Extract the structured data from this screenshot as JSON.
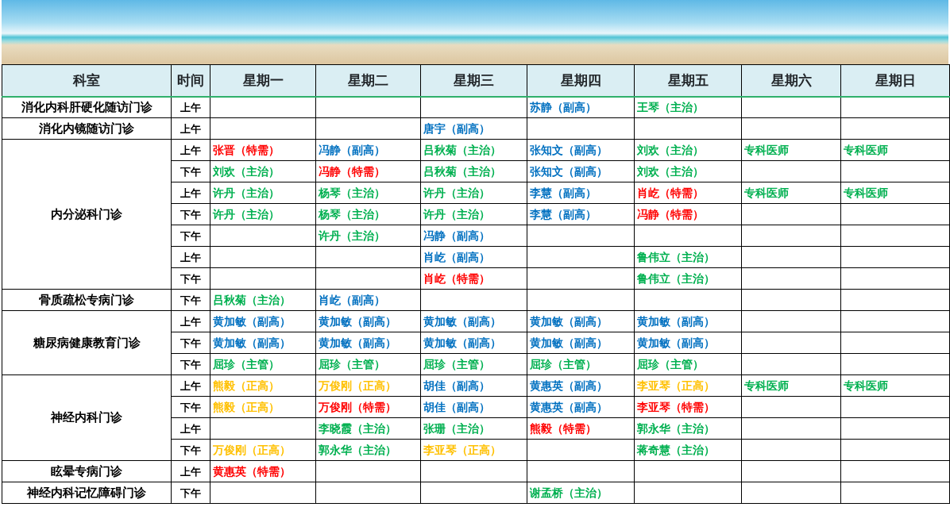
{
  "columns": [
    "科室",
    "时间",
    "星期一",
    "星期二",
    "星期三",
    "星期四",
    "星期五",
    "星期六",
    "星期日"
  ],
  "departments": [
    {
      "name": "消化内科肝硬化随访门诊",
      "rows": [
        {
          "time": "上午",
          "cells": [
            null,
            null,
            null,
            {
              "text": "苏静（副高）",
              "color": "#0070c0"
            },
            {
              "text": "王琴（主治）",
              "color": "#00b050"
            },
            null,
            null
          ]
        }
      ]
    },
    {
      "name": "消化内镜随访门诊",
      "rows": [
        {
          "time": "上午",
          "cells": [
            null,
            null,
            {
              "text": "唐宇（副高）",
              "color": "#0070c0"
            },
            null,
            null,
            null,
            null
          ]
        }
      ]
    },
    {
      "name": "内分泌科门诊",
      "rows": [
        {
          "time": "上午",
          "cells": [
            {
              "text": "张晋（特需）",
              "color": "#ff0000"
            },
            {
              "text": "冯静（副高）",
              "color": "#0070c0"
            },
            {
              "text": "吕秋菊（主治）",
              "color": "#00b050"
            },
            {
              "text": "张知文（副高）",
              "color": "#0070c0"
            },
            {
              "text": "刘欢（主治）",
              "color": "#00b050"
            },
            {
              "text": "专科医师",
              "color": "#00b050"
            },
            {
              "text": "专科医师",
              "color": "#00b050"
            }
          ]
        },
        {
          "time": "下午",
          "cells": [
            {
              "text": "刘欢（主治）",
              "color": "#00b050"
            },
            {
              "text": "冯静（特需）",
              "color": "#ff0000"
            },
            {
              "text": "吕秋菊（主治）",
              "color": "#00b050"
            },
            {
              "text": "张知文（副高）",
              "color": "#0070c0"
            },
            {
              "text": "刘欢（主治）",
              "color": "#00b050"
            },
            null,
            null
          ]
        },
        {
          "time": "上午",
          "cells": [
            {
              "text": "许丹（主治）",
              "color": "#00b050"
            },
            {
              "text": "杨琴（主治）",
              "color": "#00b050"
            },
            {
              "text": "许丹（主治）",
              "color": "#00b050"
            },
            {
              "text": "李慧（副高）",
              "color": "#0070c0"
            },
            {
              "text": "肖屹（特需）",
              "color": "#ff0000"
            },
            {
              "text": "专科医师",
              "color": "#00b050"
            },
            {
              "text": "专科医师",
              "color": "#00b050"
            }
          ]
        },
        {
          "time": "下午",
          "cells": [
            {
              "text": "许丹（主治）",
              "color": "#00b050"
            },
            {
              "text": "杨琴（主治）",
              "color": "#00b050"
            },
            {
              "text": "许丹（主治）",
              "color": "#00b050"
            },
            {
              "text": "李慧（副高）",
              "color": "#0070c0"
            },
            {
              "text": "冯静（特需）",
              "color": "#ff0000"
            },
            null,
            null
          ]
        },
        {
          "time": "下午",
          "cells": [
            null,
            {
              "text": "许丹（主治）",
              "color": "#00b050"
            },
            {
              "text": "冯静（副高）",
              "color": "#0070c0"
            },
            null,
            null,
            null,
            null
          ]
        },
        {
          "time": "上午",
          "cells": [
            null,
            null,
            {
              "text": "肖屹（副高）",
              "color": "#0070c0"
            },
            null,
            {
              "text": "鲁伟立（主治）",
              "color": "#00b050"
            },
            null,
            null
          ]
        },
        {
          "time": "下午",
          "cells": [
            null,
            null,
            {
              "text": "肖屹（特需）",
              "color": "#ff0000"
            },
            null,
            {
              "text": "鲁伟立（主治）",
              "color": "#00b050"
            },
            null,
            null
          ]
        }
      ]
    },
    {
      "name": "骨质疏松专病门诊",
      "rows": [
        {
          "time": "下午",
          "cells": [
            {
              "text": "吕秋菊（主治）",
              "color": "#00b050"
            },
            {
              "text": "肖屹（副高）",
              "color": "#0070c0"
            },
            null,
            null,
            null,
            null,
            null
          ]
        }
      ]
    },
    {
      "name": "糖尿病健康教育门诊",
      "rows": [
        {
          "time": "上午",
          "cells": [
            {
              "text": "黄加敏（副高）",
              "color": "#0070c0"
            },
            {
              "text": "黄加敏（副高）",
              "color": "#0070c0"
            },
            {
              "text": "黄加敏（副高）",
              "color": "#0070c0"
            },
            {
              "text": "黄加敏（副高）",
              "color": "#0070c0"
            },
            {
              "text": "黄加敏（副高）",
              "color": "#0070c0"
            },
            null,
            null
          ]
        },
        {
          "time": "下午",
          "cells": [
            {
              "text": "黄加敏（副高）",
              "color": "#0070c0"
            },
            {
              "text": "黄加敏（副高）",
              "color": "#0070c0"
            },
            {
              "text": "黄加敏（副高）",
              "color": "#0070c0"
            },
            {
              "text": "黄加敏（副高）",
              "color": "#0070c0"
            },
            {
              "text": "黄加敏（副高）",
              "color": "#0070c0"
            },
            null,
            null
          ]
        },
        {
          "time": "下午",
          "cells": [
            {
              "text": "屈珍（主管）",
              "color": "#00b050"
            },
            {
              "text": "屈珍（主管）",
              "color": "#00b050"
            },
            {
              "text": "屈珍（主管）",
              "color": "#00b050"
            },
            {
              "text": "屈珍（主管）",
              "color": "#00b050"
            },
            {
              "text": "屈珍（主管）",
              "color": "#00b050"
            },
            null,
            null
          ]
        }
      ]
    },
    {
      "name": "神经内科门诊",
      "rows": [
        {
          "time": "上午",
          "cells": [
            {
              "text": "熊毅（正高）",
              "color": "#ffc000"
            },
            {
              "text": "万俊刚（正高）",
              "color": "#ffc000"
            },
            {
              "text": "胡佳（副高）",
              "color": "#0070c0"
            },
            {
              "text": "黄惠英（副高）",
              "color": "#0070c0"
            },
            {
              "text": "李亚琴（正高）",
              "color": "#ffc000"
            },
            {
              "text": "专科医师",
              "color": "#00b050"
            },
            {
              "text": "专科医师",
              "color": "#00b050"
            }
          ]
        },
        {
          "time": "下午",
          "cells": [
            {
              "text": "熊毅（正高）",
              "color": "#ffc000"
            },
            {
              "text": "万俊刚（特需）",
              "color": "#ff0000"
            },
            {
              "text": "胡佳（副高）",
              "color": "#0070c0"
            },
            {
              "text": "黄惠英（副高）",
              "color": "#0070c0"
            },
            {
              "text": "李亚琴（特需）",
              "color": "#ff0000"
            },
            null,
            null
          ]
        },
        {
          "time": "上午",
          "cells": [
            null,
            {
              "text": "李晓霞（主治）",
              "color": "#00b050"
            },
            {
              "text": "张珊（主治）",
              "color": "#00b050"
            },
            {
              "text": "熊毅（特需）",
              "color": "#ff0000"
            },
            {
              "text": "郭永华（主治）",
              "color": "#00b050"
            },
            null,
            null
          ]
        },
        {
          "time": "下午",
          "cells": [
            {
              "text": "万俊刚（正高）",
              "color": "#ffc000"
            },
            {
              "text": "郭永华（主治）",
              "color": "#00b050"
            },
            {
              "text": "李亚琴（正高）",
              "color": "#ffc000"
            },
            null,
            {
              "text": "蒋奇慧（主治）",
              "color": "#00b050"
            },
            null,
            null
          ]
        }
      ]
    },
    {
      "name": "眩晕专病门诊",
      "rows": [
        {
          "time": "上午",
          "cells": [
            {
              "text": "黄惠英（特需）",
              "color": "#ff0000"
            },
            null,
            null,
            null,
            null,
            null,
            null
          ]
        }
      ]
    },
    {
      "name": "神经内科记忆障碍门诊",
      "rows": [
        {
          "time": "下午",
          "cells": [
            null,
            null,
            null,
            {
              "text": "谢孟桥（主治）",
              "color": "#00b050"
            },
            null,
            null,
            null
          ]
        }
      ]
    }
  ]
}
